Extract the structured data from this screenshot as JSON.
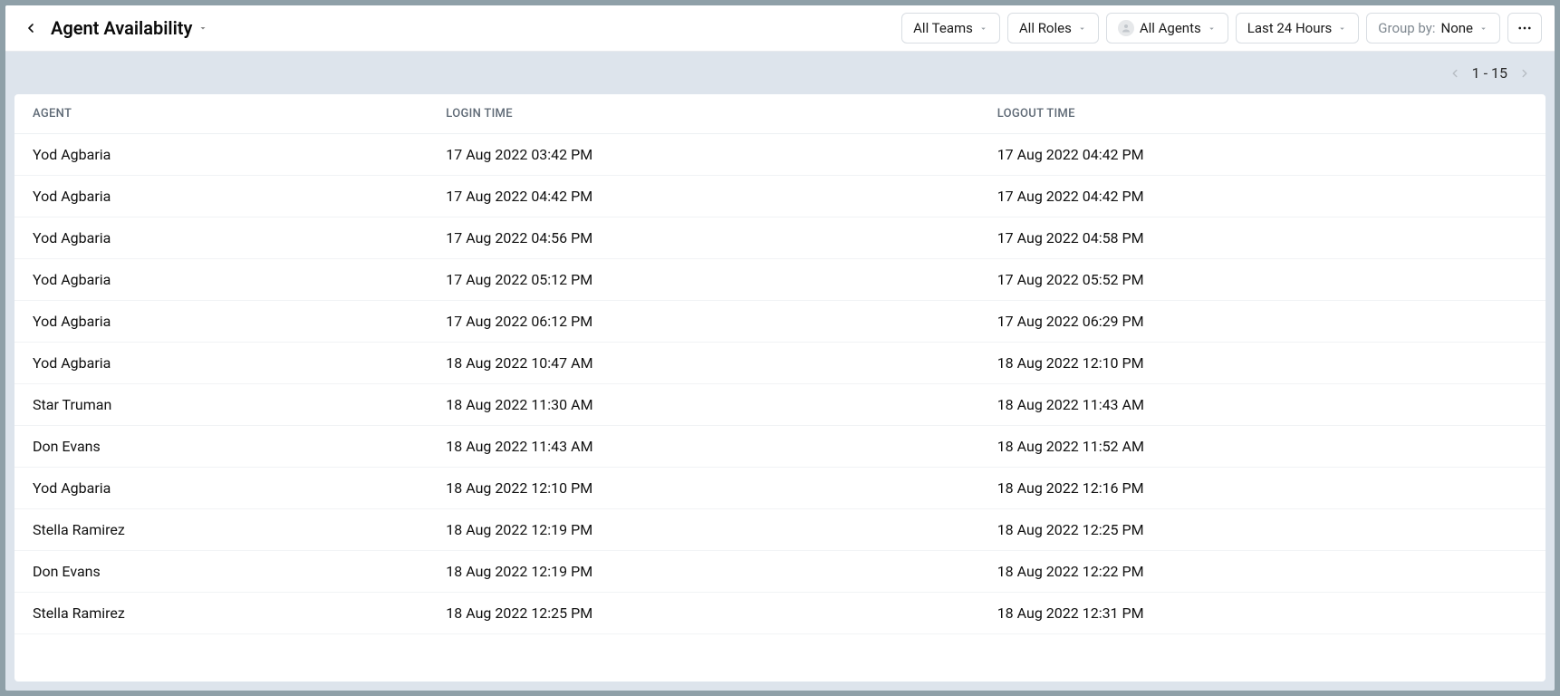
{
  "header": {
    "title": "Agent Availability",
    "filters": {
      "teams": "All Teams",
      "roles": "All Roles",
      "agents": "All Agents",
      "timerange": "Last 24 Hours",
      "group_by_label": "Group by:",
      "group_by_value": "None"
    }
  },
  "pagination": {
    "range": "1 - 15"
  },
  "table": {
    "headers": {
      "agent": "AGENT",
      "login": "LOGIN TIME",
      "logout": "LOGOUT TIME"
    },
    "rows": [
      {
        "agent": "Yod Agbaria",
        "login": "17 Aug 2022 03:42 PM",
        "logout": "17 Aug 2022 04:42 PM"
      },
      {
        "agent": "Yod Agbaria",
        "login": "17 Aug 2022 04:42 PM",
        "logout": "17 Aug 2022 04:42 PM"
      },
      {
        "agent": "Yod Agbaria",
        "login": "17 Aug 2022 04:56 PM",
        "logout": "17 Aug 2022 04:58 PM"
      },
      {
        "agent": "Yod Agbaria",
        "login": "17 Aug 2022 05:12 PM",
        "logout": "17 Aug 2022 05:52 PM"
      },
      {
        "agent": "Yod Agbaria",
        "login": "17 Aug 2022 06:12 PM",
        "logout": "17 Aug 2022 06:29 PM"
      },
      {
        "agent": "Yod Agbaria",
        "login": "18 Aug 2022 10:47 AM",
        "logout": "18 Aug 2022 12:10 PM"
      },
      {
        "agent": "Star Truman",
        "login": "18 Aug 2022 11:30 AM",
        "logout": "18 Aug 2022 11:43 AM"
      },
      {
        "agent": "Don Evans",
        "login": "18 Aug 2022 11:43 AM",
        "logout": "18 Aug 2022 11:52 AM"
      },
      {
        "agent": "Yod Agbaria",
        "login": "18 Aug 2022 12:10 PM",
        "logout": "18 Aug 2022 12:16 PM"
      },
      {
        "agent": "Stella Ramirez",
        "login": "18 Aug 2022 12:19 PM",
        "logout": "18 Aug 2022 12:25 PM"
      },
      {
        "agent": "Don Evans",
        "login": "18 Aug 2022 12:19 PM",
        "logout": "18 Aug 2022 12:22 PM"
      },
      {
        "agent": "Stella Ramirez",
        "login": "18 Aug 2022 12:25 PM",
        "logout": "18 Aug 2022 12:31 PM"
      }
    ]
  }
}
